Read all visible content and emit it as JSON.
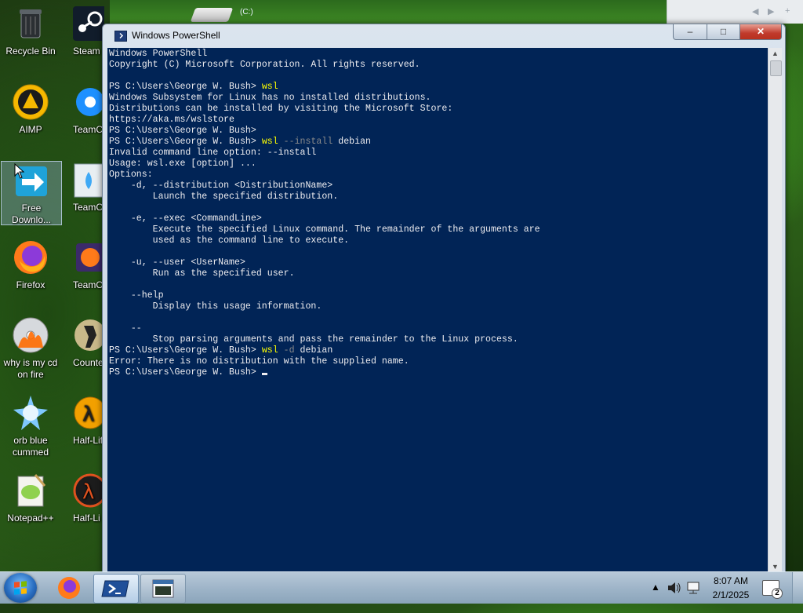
{
  "desktop": {
    "drive_label": "(C:)",
    "icons": [
      {
        "label": "Recycle Bin",
        "icon": "recycle-bin-icon"
      },
      {
        "label": "Steam",
        "icon": "steam-icon"
      },
      {
        "label": "AIMP",
        "icon": "aimp-icon"
      },
      {
        "label": "TeamC Facebo",
        "icon": "teamcity-facebook-icon"
      },
      {
        "label": "Free Downlo...",
        "icon": "free-download-manager-icon"
      },
      {
        "label": "TeamC",
        "icon": "teamc-icon"
      },
      {
        "label": "Firefox",
        "icon": "firefox-icon"
      },
      {
        "label": "TeamOS",
        "icon": "teamos-firefox-icon"
      },
      {
        "label": "why is my cd on fire",
        "icon": "burning-cd-icon"
      },
      {
        "label": "Counter- Sourc",
        "icon": "counter-strike-icon"
      },
      {
        "label": "orb blue cummed",
        "icon": "blue-orb-icon"
      },
      {
        "label": "Half-Lif",
        "icon": "half-life-icon"
      },
      {
        "label": "Notepad++",
        "icon": "notepad-plus-plus-icon"
      },
      {
        "label": "Half-Li Sourc",
        "icon": "half-life-source-icon"
      }
    ]
  },
  "window": {
    "title": "Windows PowerShell",
    "controls": {
      "minimize": "‒",
      "maximize": "□",
      "close": "✕"
    }
  },
  "console": {
    "lines": [
      "Windows PowerShell",
      "Copyright (C) Microsoft Corporation. All rights reserved.",
      "",
      "PS C:\\Users\\George W. Bush> wsl",
      "Windows Subsystem for Linux has no installed distributions.",
      "Distributions can be installed by visiting the Microsoft Store:",
      "https://aka.ms/wslstore",
      "PS C:\\Users\\George W. Bush>",
      "PS C:\\Users\\George W. Bush> wsl --install debian",
      "Invalid command line option: --install",
      "Usage: wsl.exe [option] ...",
      "Options:",
      "    -d, --distribution <DistributionName>",
      "        Launch the specified distribution.",
      "",
      "    -e, --exec <CommandLine>",
      "        Execute the specified Linux command. The remainder of the arguments are",
      "        used as the command line to execute.",
      "",
      "    -u, --user <UserName>",
      "        Run as the specified user.",
      "",
      "    --help",
      "        Display this usage information.",
      "",
      "    --",
      "        Stop parsing arguments and pass the remainder to the Linux process.",
      "PS C:\\Users\\George W. Bush> wsl -d debian",
      "Error: There is no distribution with the supplied name.",
      "PS C:\\Users\\George W. Bush> "
    ],
    "prompt": "PS C:\\Users\\George W. Bush>",
    "colors": {
      "background": "#012456",
      "text": "#eeedf0",
      "command": "#ffff00",
      "parameter": "#8a8a8a"
    }
  },
  "taskbar": {
    "clock_time": "8:07 AM",
    "clock_date": "2/1/2025",
    "notification_count": "2",
    "apps": [
      {
        "name": "Firefox",
        "icon": "firefox-icon"
      },
      {
        "name": "Windows PowerShell",
        "icon": "powershell-icon",
        "active": true
      },
      {
        "name": "Terminal",
        "icon": "console-window-icon"
      }
    ]
  }
}
